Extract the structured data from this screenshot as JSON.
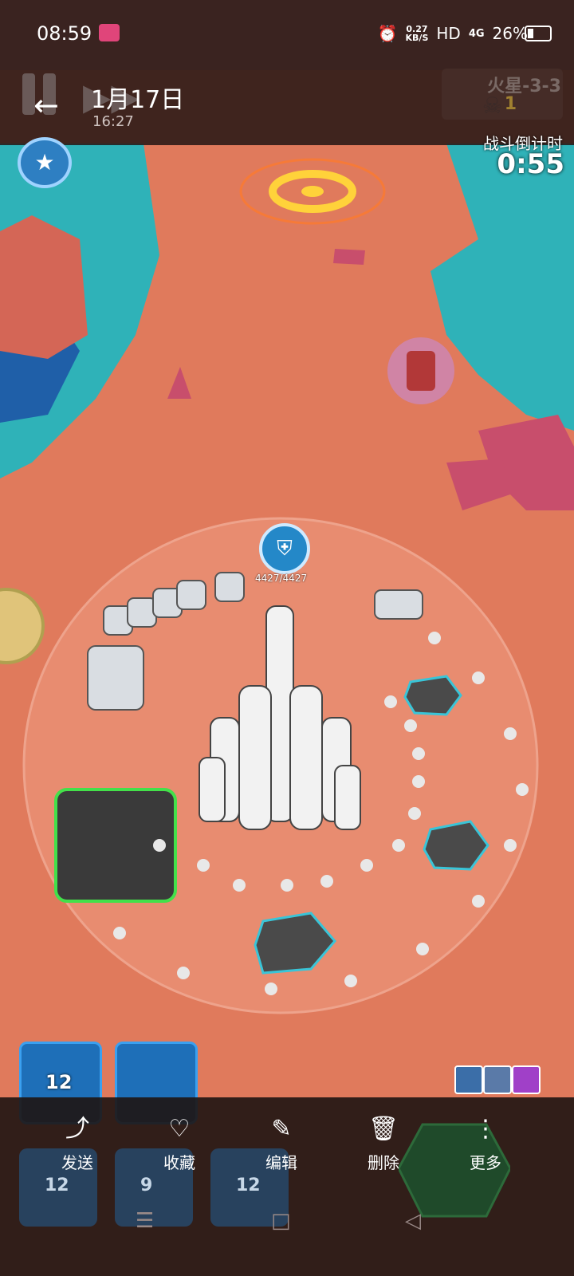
{
  "status_bar": {
    "time": "08:59",
    "speed_value": "0.27",
    "speed_unit": "KB/S",
    "hd": "HD",
    "network": "4G",
    "battery": "26%"
  },
  "viewer": {
    "date": "1月17日",
    "time": "16:27"
  },
  "game": {
    "stage": "火星-3-3",
    "kills": "1",
    "countdown_label": "战斗倒计时",
    "countdown": "0:55",
    "base_hp": "4427/4427",
    "cards": [
      {
        "level": "12"
      },
      {
        "level": ""
      }
    ],
    "ghost_cards": [
      {
        "level": "12"
      },
      {
        "level": "9"
      },
      {
        "level": "12"
      }
    ]
  },
  "actions": [
    {
      "label": "发送",
      "icon": "share-icon"
    },
    {
      "label": "收藏",
      "icon": "heart-icon"
    },
    {
      "label": "编辑",
      "icon": "edit-icon"
    },
    {
      "label": "删除",
      "icon": "trash-icon"
    },
    {
      "label": "更多",
      "icon": "more-icon"
    }
  ],
  "colors": {
    "ground": "#e07a5c",
    "water": "#2fb2b8",
    "dome": "#f2a38a",
    "card_blue": "#1e6fb8"
  }
}
